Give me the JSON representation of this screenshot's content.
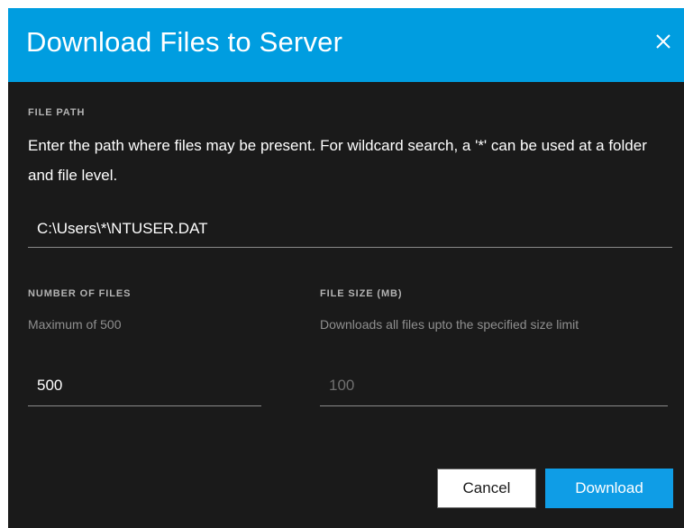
{
  "dialog": {
    "title": "Download Files to Server",
    "close_icon": "close-icon"
  },
  "file_path": {
    "label": "FILE PATH",
    "description": "Enter the path where files may be present. For wildcard search, a '*' can be used at a folder and file level.",
    "value": "C:\\Users\\*\\NTUSER.DAT"
  },
  "number_of_files": {
    "label": "NUMBER OF FILES",
    "hint": "Maximum of 500",
    "value": "500"
  },
  "file_size": {
    "label": "FILE SIZE (MB)",
    "hint": "Downloads all files upto the specified size limit",
    "placeholder": "100"
  },
  "buttons": {
    "cancel": "Cancel",
    "download": "Download"
  },
  "colors": {
    "header_accent": "#009de0",
    "dialog_background": "#1a1a1a",
    "primary_button": "#0f9de6"
  }
}
